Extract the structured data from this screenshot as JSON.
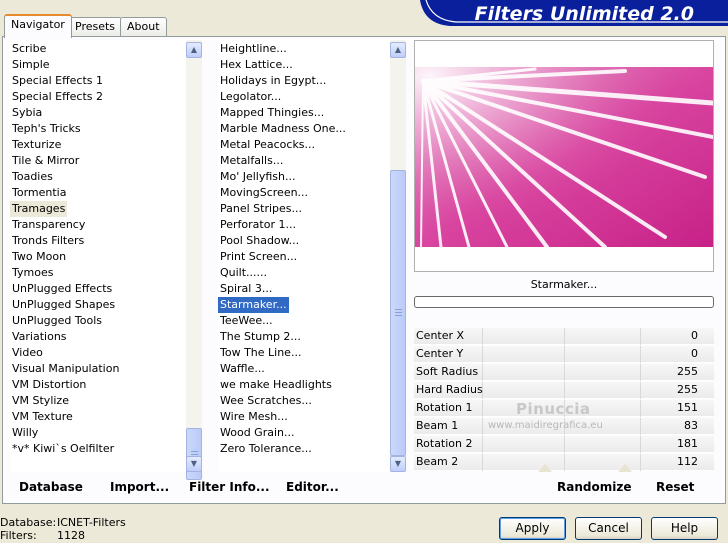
{
  "tabs": [
    "Navigator",
    "Presets",
    "About"
  ],
  "title": "Filters Unlimited 2.0",
  "categories": {
    "items": [
      "Scribe",
      "Simple",
      "Special Effects 1",
      "Special Effects 2",
      "Sybia",
      "Teph's Tricks",
      "Texturize",
      "Tile & Mirror",
      "Toadies",
      "Tormentia",
      "Tramages",
      "Transparency",
      "Tronds Filters",
      "Two Moon",
      "Tymoes",
      "UnPlugged Effects",
      "UnPlugged Shapes",
      "UnPlugged Tools",
      "Variations",
      "Video",
      "Visual Manipulation",
      "VM Distortion",
      "VM Stylize",
      "VM Texture",
      "Willy",
      "*v* Kiwi`s Oelfilter"
    ],
    "selected": "Tramages"
  },
  "filters": {
    "items": [
      "Heightline...",
      "Hex Lattice...",
      "Holidays in Egypt...",
      "Legolator...",
      "Mapped Thingies...",
      "Marble Madness One...",
      "Metal Peacocks...",
      "Metalfalls...",
      "Mo' Jellyfish...",
      "MovingScreen...",
      "Panel Stripes...",
      "Perforator 1...",
      "Pool Shadow...",
      "Print Screen...",
      "Quilt......",
      "Spiral 3...",
      "Starmaker...",
      "TeeWee...",
      "The Stump 2...",
      "Tow The Line...",
      "Waffle...",
      "we make Headlights",
      "Wee Scratches...",
      "Wire Mesh...",
      "Wood Grain...",
      "Zero Tolerance..."
    ],
    "selected": "Starmaker..."
  },
  "preview": {
    "filter_name": "Starmaker...",
    "colors": {
      "magenta": "#d42d93",
      "pink": "#e67ac0",
      "white": "#ffffff"
    }
  },
  "parameters": [
    {
      "label": "Center X",
      "value": "0"
    },
    {
      "label": "Center Y",
      "value": "0"
    },
    {
      "label": "Soft Radius",
      "value": "255"
    },
    {
      "label": "Hard Radius",
      "value": "255"
    },
    {
      "label": "Rotation 1",
      "value": "151"
    },
    {
      "label": "Beam 1",
      "value": "83"
    },
    {
      "label": "Rotation 2",
      "value": "181"
    },
    {
      "label": "Beam 2",
      "value": "112"
    }
  ],
  "watermark": {
    "name": "Pinuccia",
    "url": "www.maidiregrafica.eu"
  },
  "links": {
    "database": "Database",
    "import": "Import...",
    "filter_info": "Filter Info...",
    "editor": "Editor...",
    "randomize": "Randomize",
    "reset": "Reset"
  },
  "status": {
    "database_label": "Database:",
    "database_value": "ICNET-Filters",
    "filters_label": "Filters:",
    "filters_value": "1128"
  },
  "buttons": {
    "apply": "Apply",
    "cancel": "Cancel",
    "help": "Help"
  },
  "accent_colors": {
    "banner": "#0a1f9c",
    "selection": "#316ac5",
    "tab_highlight": "#e68b2c"
  }
}
